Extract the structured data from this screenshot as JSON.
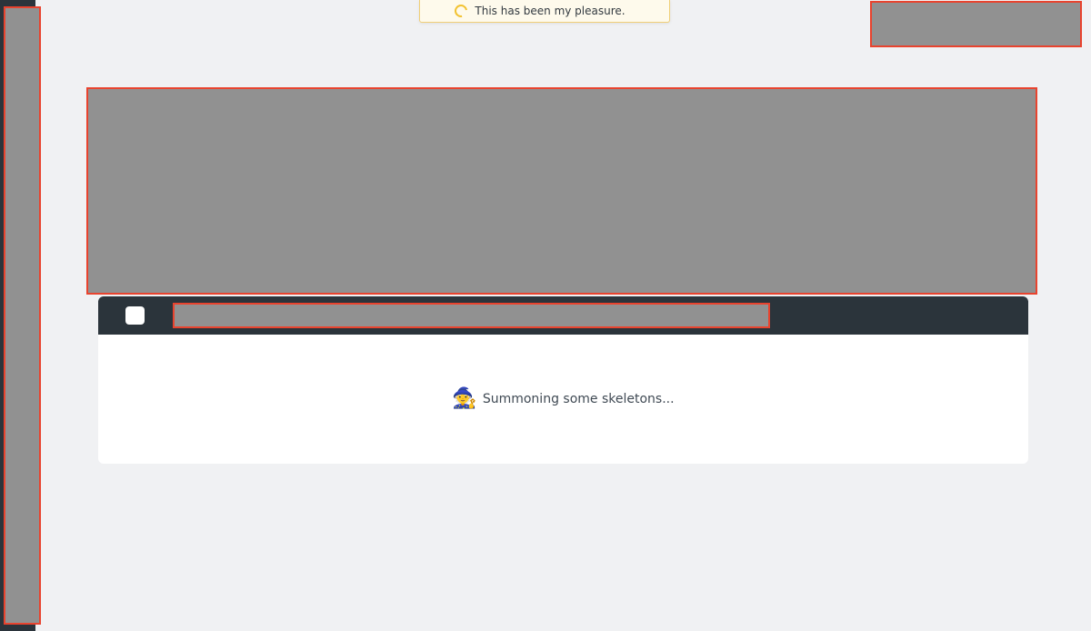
{
  "toast": {
    "icon": "spinner-icon",
    "message": "This has been my pleasure."
  },
  "panel": {
    "loading_icon": "witch-icon",
    "loading_glyph": "🧙",
    "loading_text": "Summoning some skeletons..."
  },
  "colors": {
    "background": "#f0f1f3",
    "dark_rail": "#2b343b",
    "panel_header": "#2b343b",
    "toast_bg": "#fefaec",
    "toast_border": "#f0cf78",
    "spinner": "#f2c230",
    "redaction_fill": "#919191",
    "redaction_outline": "#e8432e"
  }
}
